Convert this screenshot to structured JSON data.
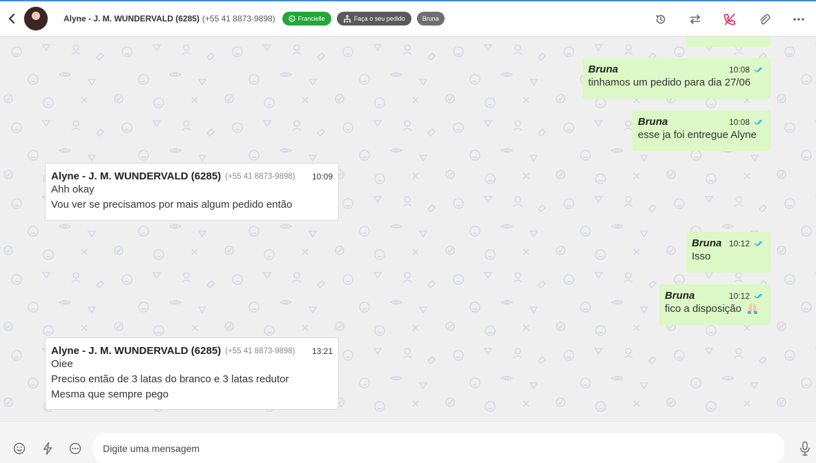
{
  "header": {
    "contact_name": "Alyne - J. M. WUNDERVALD (6285)",
    "contact_phone": "(+55 41 8873-9898)",
    "tags": [
      {
        "label": "Francielle",
        "color": "#25a63b",
        "icon": "whatsapp-icon"
      },
      {
        "label": "Faça o seu pedido",
        "color": "#5a5a5a",
        "icon": "flow-icon"
      },
      {
        "label": "Bruna",
        "color": "#6f6f6f"
      }
    ],
    "actions": [
      "history-icon",
      "transfer-icon",
      "end-call-icon",
      "attach-icon",
      "more-icon"
    ]
  },
  "messages": [
    {
      "direction": "out",
      "author": "Bruna",
      "time": "10:08",
      "lines": [
        "tinhamos um pedido para dia 27/06"
      ]
    },
    {
      "direction": "out",
      "author": "Bruna",
      "time": "10:08",
      "lines": [
        "esse ja foi entregue Alyne"
      ]
    },
    {
      "direction": "in",
      "author": "Alyne - J. M. WUNDERVALD (6285)",
      "phone": "(+55 41 8873-9898)",
      "time": "10:09",
      "lines": [
        "Ahh okay",
        "Vou ver se precisamos por mais algum pedido então"
      ]
    },
    {
      "direction": "out",
      "author": "Bruna",
      "time": "10:12",
      "lines": [
        "Isso"
      ]
    },
    {
      "direction": "out",
      "author": "Bruna",
      "time": "10:12",
      "lines": [
        "fico a disposição"
      ],
      "emoji": "folded-hands"
    },
    {
      "direction": "in",
      "author": "Alyne - J. M. WUNDERVALD (6285)",
      "phone": "(+55 41 8873-9898)",
      "time": "13:21",
      "lines": [
        "Oiee",
        "Preciso então de 3 latas do branco e 3 latas redutor",
        "Mesma que sempre pego"
      ]
    }
  ],
  "composer": {
    "placeholder": "Digite uma mensagem",
    "buttons": [
      "emoji-icon",
      "quick-reply-icon",
      "more-options-icon",
      "microphone-icon"
    ]
  },
  "colors": {
    "accent": "#3c8dde",
    "outgoing_bubble": "#dcf8c6",
    "incoming_bubble": "#ffffff",
    "read_ticks": "#34b7f1",
    "end_call": "#e0245e"
  }
}
